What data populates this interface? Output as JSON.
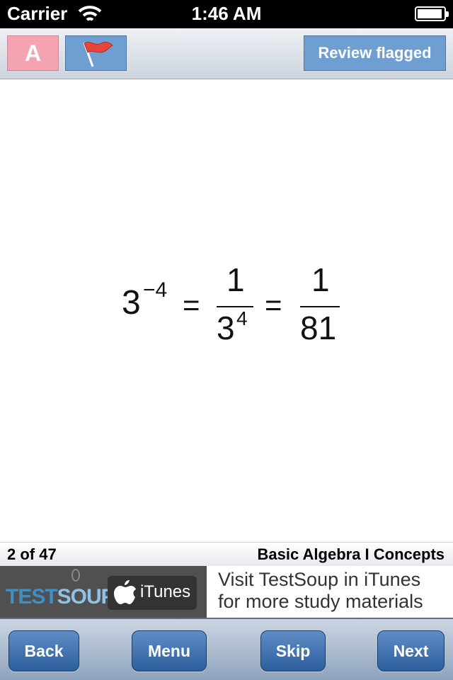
{
  "status_bar": {
    "carrier": "Carrier",
    "time": "1:46 AM",
    "wifi_icon": "wifi-icon",
    "battery_icon": "battery-icon"
  },
  "toolbar": {
    "font_button_label": "A",
    "font_button_color": "#f4a3b1",
    "flag_icon": "flag-icon",
    "flag_color": "#e8443a",
    "review_label": "Review flagged",
    "button_color": "#6f9ed3"
  },
  "equation": {
    "base": "3",
    "exponent": "−4",
    "equals": "=",
    "frac1_numerator": "1",
    "frac1_denominator_base": "3",
    "frac1_denominator_exp": "4",
    "frac2_numerator": "1",
    "frac2_denominator": "81"
  },
  "info_bar": {
    "progress": "2 of 47",
    "deck_title": "Basic Algebra I Concepts"
  },
  "ad_banner": {
    "logo_test": "TEST",
    "logo_soup": "SOUP",
    "apple_icon": "apple-icon",
    "itunes_label": "iTunes",
    "line1": "Visit TestSoup in iTunes",
    "line2": "for more study materials"
  },
  "bottom_nav": {
    "back": "Back",
    "menu": "Menu",
    "skip": "Skip",
    "next": "Next",
    "accent": "#2c5f9e"
  }
}
